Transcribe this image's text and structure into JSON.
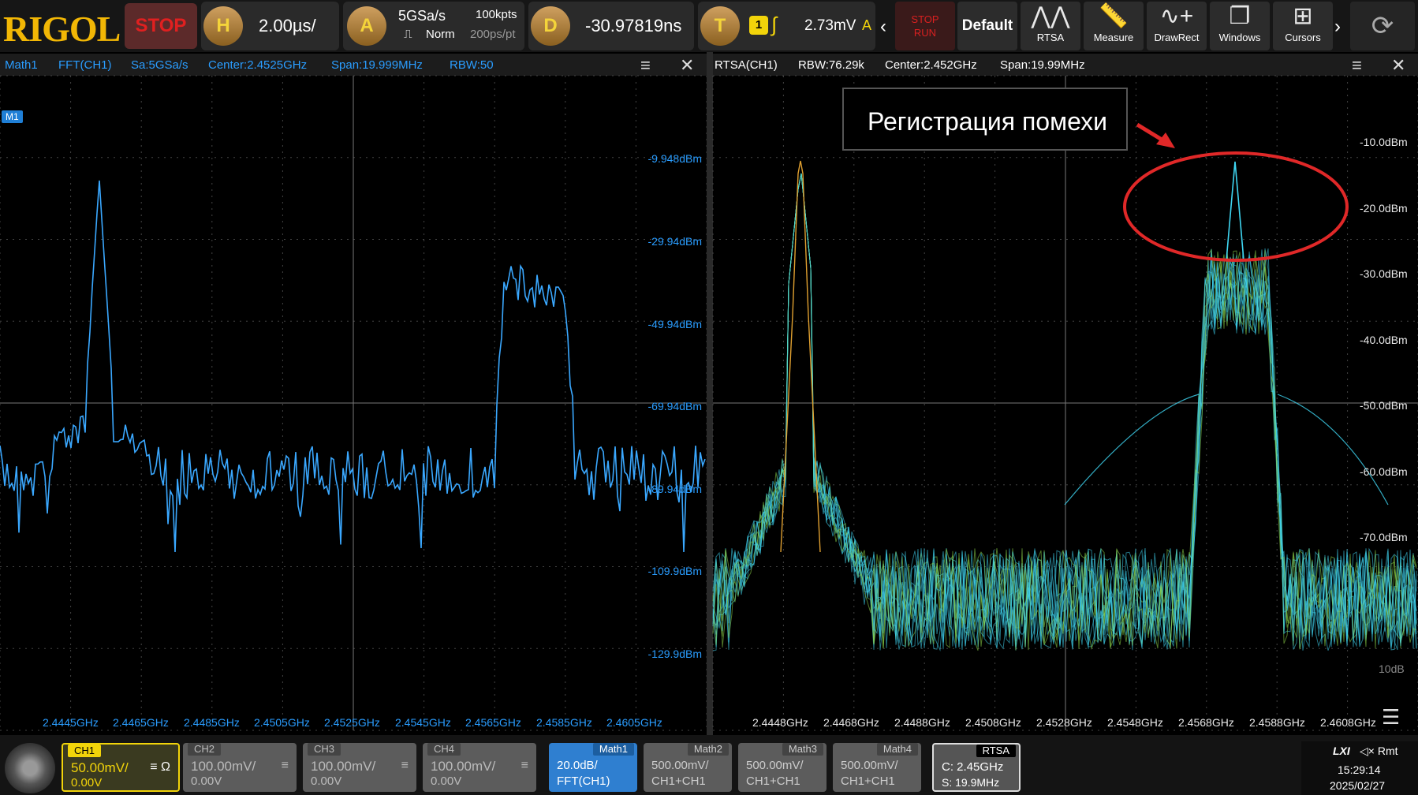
{
  "toolbar": {
    "logo": "RIGOL",
    "run_state": "STOP",
    "horizontal": {
      "badge": "H",
      "timebase": "2.00µs/"
    },
    "acquire": {
      "badge": "A",
      "sample_rate": "5GSa/s",
      "memory_depth": "100kpts",
      "mode": "Norm",
      "resolution": "200ps/pt"
    },
    "delay": {
      "badge": "D",
      "value": "-30.97819ns"
    },
    "trigger": {
      "badge": "T",
      "source": "1",
      "level": "2.73mV",
      "mode": "A"
    },
    "buttons": [
      {
        "label": "STOP\nRUN",
        "icon": ""
      },
      {
        "label": "Default",
        "icon": ""
      },
      {
        "label": "RTSA",
        "icon": "spectrum-icon"
      },
      {
        "label": "Measure",
        "icon": "ruler-icon"
      },
      {
        "label": "DrawRect",
        "icon": "draw-icon"
      },
      {
        "label": "Windows",
        "icon": "windows-icon"
      },
      {
        "label": "Cursors",
        "icon": "cursor-icon"
      }
    ],
    "stoprun_label_top": "STOP",
    "stoprun_label_bottom": "RUN"
  },
  "left_panel": {
    "header": {
      "math": "Math1",
      "source": "FFT(CH1)",
      "sample_rate": "Sa:5GSa/s",
      "center": "Center:2.4525GHz",
      "span": "Span:19.999MHz",
      "rbw": "RBW:50"
    },
    "marker": "M1",
    "y_labels": [
      "-9.948dBm",
      "-29.94dBm",
      "-49.94dBm",
      "-69.94dBm",
      "-89.94dBm",
      "-109.9dBm",
      "-129.9dBm"
    ],
    "x_labels": [
      "2.4445GHz",
      "2.4465GHz",
      "2.4485GHz",
      "2.4505GHz",
      "2.4525GHz",
      "2.4545GHz",
      "2.4565GHz",
      "2.4585GHz",
      "2.4605GHz"
    ]
  },
  "right_panel": {
    "header": {
      "source": "RTSA(CH1)",
      "rbw": "RBW:76.29k",
      "center": "Center:2.452GHz",
      "span": "Span:19.99MHz"
    },
    "y_labels": [
      "-10.0dBm",
      "-20.0dBm",
      "-30.0dBm",
      "-40.0dBm",
      "-50.0dBm",
      "-60.0dBm",
      "-70.0dBm",
      "10dB"
    ],
    "x_labels": [
      "2.4448GHz",
      "2.4468GHz",
      "2.4488GHz",
      "2.4508GHz",
      "2.4528GHz",
      "2.4548GHz",
      "2.4568GHz",
      "2.4588GHz",
      "2.4608GHz"
    ],
    "annotation": "Регистрация помехи"
  },
  "colors": {
    "trace_blue": "#3aa8ff",
    "rtsa_cyan": "#3fd6f2",
    "rtsa_green": "#8fd84a",
    "annotation_red": "#e02828",
    "logo_gold": "#f2b705"
  },
  "bottom": {
    "channels": [
      {
        "name": "CH1",
        "scale": "50.00mV/",
        "offset": "0.00V",
        "extra": "≡ Ω"
      },
      {
        "name": "CH2",
        "scale": "100.00mV/",
        "offset": "0.00V",
        "extra": "≡"
      },
      {
        "name": "CH3",
        "scale": "100.00mV/",
        "offset": "0.00V",
        "extra": "≡"
      },
      {
        "name": "CH4",
        "scale": "100.00mV/",
        "offset": "0.00V",
        "extra": "≡"
      }
    ],
    "maths": [
      {
        "name": "Math1",
        "line1": "20.0dB/",
        "line2": "FFT(CH1)"
      },
      {
        "name": "Math2",
        "line1": "500.00mV/",
        "line2": "CH1+CH1"
      },
      {
        "name": "Math3",
        "line1": "500.00mV/",
        "line2": "CH1+CH1"
      },
      {
        "name": "Math4",
        "line1": "500.00mV/",
        "line2": "CH1+CH1"
      }
    ],
    "rtsa": {
      "name": "RTSA",
      "center": "C: 2.45GHz",
      "span": "S: 19.9MHz"
    },
    "status": {
      "lxi": "LXI",
      "icons": "◁× Rmt",
      "time": "15:29:14",
      "date": "2025/02/27"
    }
  }
}
